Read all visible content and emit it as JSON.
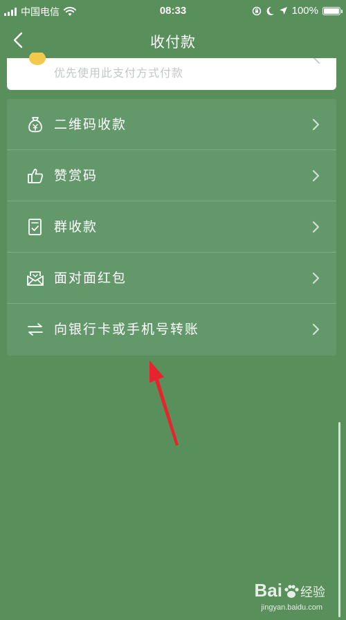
{
  "status_bar": {
    "carrier": "中国电信",
    "time": "08:33",
    "battery": "100%",
    "battery_level": 1.0
  },
  "nav": {
    "title": "收付款",
    "back_icon": "chevron-left-icon"
  },
  "preferred_payment": {
    "text": "优先使用此支付方式付款",
    "icon_color": "#f2c94c"
  },
  "menu": {
    "items": [
      {
        "label": "二维码收款",
        "icon": "money-bag-icon"
      },
      {
        "label": "赞赏码",
        "icon": "thumbs-up-icon"
      },
      {
        "label": "群收款",
        "icon": "group-collect-icon"
      },
      {
        "label": "面对面红包",
        "icon": "red-packet-icon"
      },
      {
        "label": "向银行卡或手机号转账",
        "icon": "transfer-icon"
      }
    ]
  },
  "annotation": {
    "arrow_color": "#e8232e"
  },
  "watermark": {
    "brand": "Bai",
    "brand_cn": "经验",
    "url": "jingyan.baidu.com"
  },
  "colors": {
    "background": "#588f5b",
    "card": "#63996a"
  }
}
